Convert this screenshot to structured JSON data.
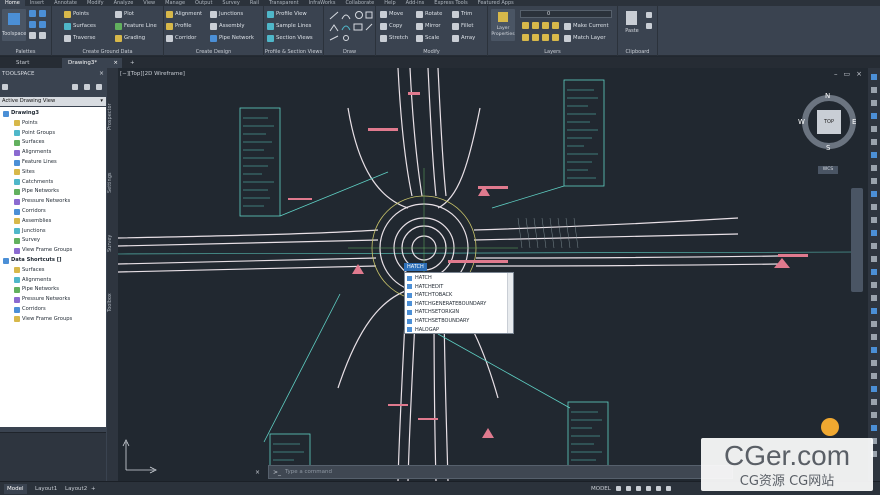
{
  "ribbon_tabs": [
    "Home",
    "Insert",
    "Annotate",
    "Modify",
    "Analyze",
    "View",
    "Manage",
    "Output",
    "Survey",
    "Rail",
    "Transparent",
    "InfraWorks",
    "Collaborate",
    "Help",
    "Add-ins",
    "Express Tools",
    "Featured Apps"
  ],
  "ribbon": {
    "toolspace_label": "Toolspace",
    "palettes_title": "Palettes",
    "ground": {
      "points": "Points",
      "surfaces": "Surfaces",
      "traverse": "Traverse",
      "plot": "Plot",
      "feature_line": "Feature Line",
      "grading": "Grading",
      "title": "Create Ground Data"
    },
    "design": {
      "alignment": "Alignment",
      "profile": "Profile",
      "corridor": "Corridor",
      "junctions": "Junctions",
      "assembly": "Assembly",
      "pipe_network": "Pipe Network",
      "title": "Create Design"
    },
    "profile_section": {
      "profile_view": "Profile View",
      "sample_lines": "Sample Lines",
      "section_views": "Section Views",
      "title": "Profile & Section Views"
    },
    "draw_title": "Draw",
    "modify": {
      "move": "Move",
      "rotate": "Rotate",
      "trim": "Trim",
      "copy": "Copy",
      "mirror": "Mirror",
      "fillet": "Fillet",
      "stretch": "Stretch",
      "scale": "Scale",
      "array": "Array",
      "title": "Modify"
    },
    "layers": {
      "layer_properties": "Layer Properties",
      "make_current": "Make Current",
      "match_layer": "Match Layer",
      "layer_value": "0",
      "title": "Layers"
    },
    "clipboard": {
      "paste": "Paste",
      "title": "Clipboard"
    }
  },
  "file_tabs": {
    "start": "Start",
    "drawing": "Drawing3*",
    "add": "+"
  },
  "toolspace": {
    "title": "TOOLSPACE",
    "view_select": "Active Drawing View",
    "tree": [
      {
        "label": "Drawing3",
        "level": 0
      },
      {
        "label": "Points",
        "level": 1
      },
      {
        "label": "Point Groups",
        "level": 1
      },
      {
        "label": "Surfaces",
        "level": 1
      },
      {
        "label": "Alignments",
        "level": 1
      },
      {
        "label": "Feature Lines",
        "level": 1
      },
      {
        "label": "Sites",
        "level": 1
      },
      {
        "label": "Catchments",
        "level": 1
      },
      {
        "label": "Pipe Networks",
        "level": 1
      },
      {
        "label": "Pressure Networks",
        "level": 1
      },
      {
        "label": "Corridors",
        "level": 1
      },
      {
        "label": "Assemblies",
        "level": 1
      },
      {
        "label": "Junctions",
        "level": 1
      },
      {
        "label": "Survey",
        "level": 1
      },
      {
        "label": "View Frame Groups",
        "level": 1
      },
      {
        "label": "Data Shortcuts []",
        "level": 0
      },
      {
        "label": "Surfaces",
        "level": 1
      },
      {
        "label": "Alignments",
        "level": 1
      },
      {
        "label": "Pipe Networks",
        "level": 1
      },
      {
        "label": "Pressure Networks",
        "level": 1
      },
      {
        "label": "Corridors",
        "level": 1
      },
      {
        "label": "View Frame Groups",
        "level": 1
      }
    ],
    "side_tabs": [
      "Prospector",
      "Settings",
      "Survey",
      "Toolbox"
    ]
  },
  "viewport": {
    "label": "[−][Top][2D Wireframe]",
    "viewcube": {
      "top": "TOP",
      "n": "N",
      "s": "S",
      "e": "E",
      "w": "W",
      "wcs": "WCS"
    }
  },
  "autocomplete": {
    "typed": "HATCH",
    "items": [
      "HATCH",
      "HATCHEDIT",
      "HATCHTOBACK",
      "HATCHGENERATEBOUNDARY",
      "HATCHSETORIGIN",
      "HATCHSETBOUNDARY",
      "HALOGAP"
    ]
  },
  "command_line": {
    "placeholder": "Type a command"
  },
  "status_bar": {
    "model": "Model",
    "layout1": "Layout1",
    "layout2": "Layout2",
    "model_space": "MODEL"
  },
  "watermark": {
    "title": "CGer.com",
    "subtitle": "CG资源 CG网站"
  },
  "colors": {
    "ribbon_bg": "#3a4350",
    "canvas_bg": "#212830",
    "road_white": "#e8e0e6",
    "road_pink": "#e07a8e",
    "leader_cyan": "#5fd0c4",
    "label_cyan": "#5fd0c4",
    "accent_blue": "#2d6fb8"
  }
}
